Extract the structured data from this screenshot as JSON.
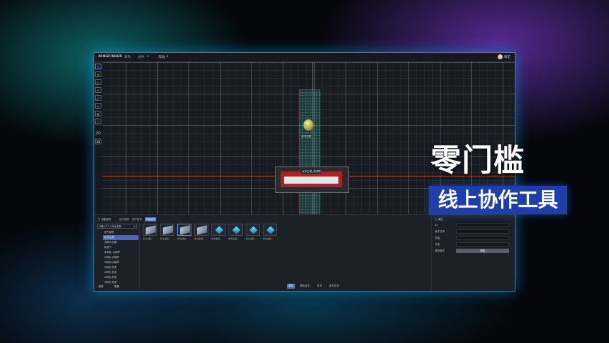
{
  "app": {
    "logo": "KINGFISHER",
    "menus": [
      "草鸟",
      "文件",
      "帮助"
    ],
    "user": {
      "name": "周定"
    }
  },
  "canvas": {
    "sphere_label": "水冷主机",
    "machine_label": "水冷主机_冷冻机"
  },
  "toolbar": {
    "tools": [
      "edit-tool",
      "layers-tool",
      "box-tool",
      "paint-tool",
      "transform-tool",
      "plane-tool",
      "panel-tool",
      "info-tool"
    ],
    "view_2d": "2D",
    "view_3d": "3D"
  },
  "library": {
    "tabs": [
      "设备图库",
      "官方组件",
      "用户组件",
      "收藏组件"
    ],
    "active_tab": 3,
    "category_select": "A场 / F1 / 冷水主机",
    "tree": [
      "燃气锅炉",
      "冷水主机",
      "多联水设备",
      "除湿干",
      "单风机-水锅炉",
      "2风机-水锅炉",
      "2风机-水锅炉",
      "2风机-热泵",
      "4风机-热泵",
      "4风机-热泵",
      "4风机-热泵"
    ],
    "tree_active": 1,
    "thumbs": [
      {
        "label": "水冷主机_",
        "kind": "chiller"
      },
      {
        "label": "水冷主机_",
        "kind": "chiller"
      },
      {
        "label": "水冷主机_",
        "kind": "chiller"
      },
      {
        "label": "水冷主机_",
        "kind": "chiller"
      },
      {
        "label": "水冷主机_",
        "kind": "cube"
      },
      {
        "label": "水冷主机_",
        "kind": "cube"
      },
      {
        "label": "水冷主机_",
        "kind": "cube"
      },
      {
        "label": "水冷主机_",
        "kind": "cube"
      }
    ],
    "thumb_active": 2,
    "footer_left": [
      "组件",
      "集集"
    ]
  },
  "properties": {
    "title": "属性",
    "fields": [
      "ID",
      "组件名称",
      "作者",
      "分类",
      "更新组件"
    ],
    "update_button": "更新"
  },
  "footer_tabs": [
    "属性",
    "辅助信息",
    "材料",
    "组件信息"
  ],
  "footer_active": 0,
  "overlay": {
    "headline": "零门槛",
    "subline": "线上协作工具"
  },
  "colors": {
    "accent": "#4c6bb8",
    "window_border": "#3a7fa8",
    "banner": "#1f3fa8"
  }
}
